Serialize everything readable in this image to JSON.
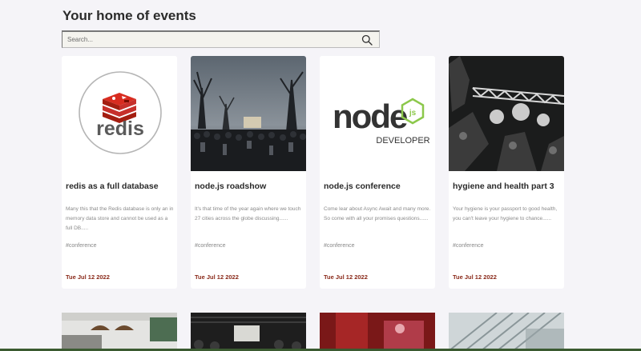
{
  "header": {
    "title": "Your home of events"
  },
  "search": {
    "placeholder": "Search...",
    "icon": "search-icon"
  },
  "colors": {
    "background": "#f5f4f8",
    "card": "#ffffff",
    "date": "#8a2a1a",
    "redis_red": "#c6302b",
    "node_green": "#8cc84b"
  },
  "events": [
    {
      "title": "redis as a full database",
      "description": "Many this that the Redis database is only an in memory data store and cannot be used as a full DB.....",
      "tag": "#conference",
      "date": "Tue Jul 12 2022",
      "image": "redis-logo",
      "logo_text": "redis"
    },
    {
      "title": "node.js roadshow",
      "description": "It's that time of the year again where we touch 27 cities across the globe discussing......",
      "tag": "#conference",
      "date": "Tue Jul 12 2022",
      "image": "crowd-trees-photo"
    },
    {
      "title": "node.js conference",
      "description": "Come lear about Async Await and many more. So come with all your promises questions......",
      "tag": "#conference",
      "date": "Tue Jul 12 2022",
      "image": "nodejs-developer-logo",
      "logo_text": "node",
      "logo_badge": "js",
      "logo_subtext": "DEVELOPER"
    },
    {
      "title": "hygiene and health part 3",
      "description": "Your hygiene is your passport to good health, you can't leave your hygiene to chance......",
      "tag": "#conference",
      "date": "Tue Jul 12 2022",
      "image": "concert-lights-photo"
    }
  ],
  "more_events": [
    {
      "image": "meeting-room-photo"
    },
    {
      "image": "dark-auditorium-photo"
    },
    {
      "image": "red-stage-photo"
    },
    {
      "image": "office-ceiling-photo"
    }
  ]
}
